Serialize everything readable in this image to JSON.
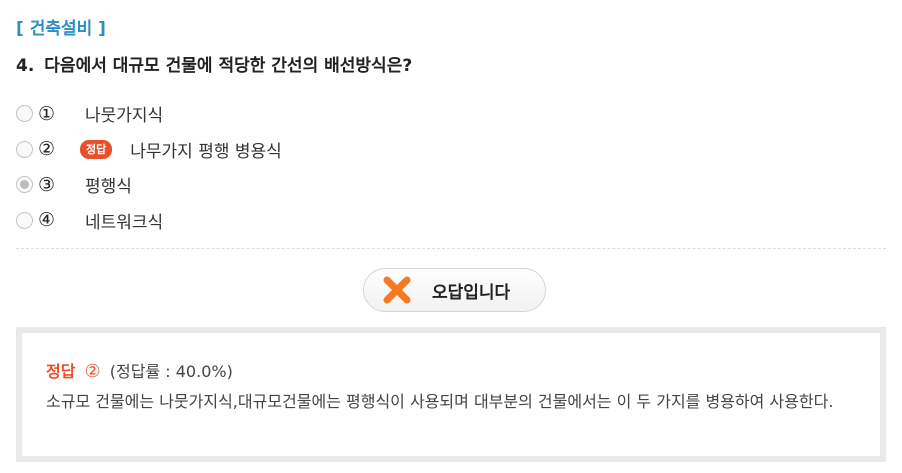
{
  "category": "[ 건축설비 ]",
  "question": {
    "number": "4.",
    "text": "다음에서 대규모 건물에 적당한 간선의 배선방식은?"
  },
  "options": [
    {
      "num": "①",
      "text": "나뭇가지식",
      "selected": false,
      "correct": false
    },
    {
      "num": "②",
      "text": "나무가지 평행 병용식",
      "selected": false,
      "correct": true,
      "badge": "정답"
    },
    {
      "num": "③",
      "text": "평행식",
      "selected": true,
      "correct": false
    },
    {
      "num": "④",
      "text": "네트워크식",
      "selected": false,
      "correct": false
    }
  ],
  "result": {
    "label": "오답입니다",
    "icon": "x-icon",
    "icon_color": "#f47a20"
  },
  "explanation": {
    "title": "정답",
    "answer_num": "②",
    "rate": "(정답률 : 40.0%)",
    "text": "소규모 건물에는 나뭇가지식,대규모건물에는 평행식이 사용되며 대부분의 건물에서는 이 두 가지를 병용하여 사용한다."
  },
  "colors": {
    "category": "#2d8fc4",
    "correct_badge": "#e9502a",
    "answer_accent": "#e9502a"
  }
}
